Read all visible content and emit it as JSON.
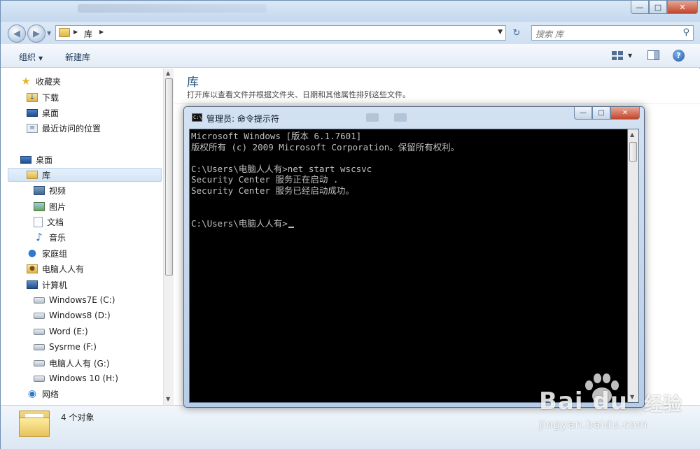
{
  "explorer": {
    "address": {
      "segment": "库"
    },
    "search": {
      "placeholder": "搜索 库"
    },
    "toolbar": {
      "organize_label": "组织",
      "new_library_label": "新建库"
    },
    "sidebar": {
      "favorites": {
        "label": "收藏夹",
        "items": [
          "下载",
          "桌面",
          "最近访问的位置"
        ]
      },
      "desktop": {
        "label": "桌面"
      },
      "libraries": {
        "label": "库",
        "items": [
          "视频",
          "图片",
          "文档",
          "音乐"
        ]
      },
      "homegroup": {
        "label": "家庭组"
      },
      "user": {
        "label": "电脑人人有"
      },
      "computer": {
        "label": "计算机",
        "drives": [
          "Windows7E (C:)",
          "Windows8 (D:)",
          "Word (E:)",
          "Sysrme (F:)",
          "电脑人人有 (G:)",
          "Windows 10 (H:)"
        ]
      },
      "network": {
        "label": "网络"
      }
    },
    "content": {
      "title": "库",
      "subtitle": "打开库以查看文件并根据文件夹、日期和其他属性排列这些文件。"
    },
    "details": {
      "count_text": "4 个对象"
    }
  },
  "cmd": {
    "title": "管理员: 命令提示符",
    "icon_text": "C:\\",
    "lines": [
      "Microsoft Windows [版本 6.1.7601]",
      "版权所有 (c) 2009 Microsoft Corporation。保留所有权利。",
      "",
      "C:\\Users\\电脑人人有>net start wscsvc",
      "Security Center 服务正在启动 .",
      "Security Center 服务已经启动成功。",
      "",
      "",
      "C:\\Users\\电脑人人有>"
    ]
  },
  "watermark": {
    "brand": "Bai  du",
    "cn": "经验",
    "url": "jingyan.baidu.com"
  },
  "colors": {
    "cmd_background": "#000000",
    "cmd_text": "#c0c0c0",
    "accent": "#1e4e79",
    "selection": "#d4e5f7"
  },
  "icons": {
    "favorites": "star-icon",
    "download": "download-folder-icon",
    "desktop": "desktop-icon",
    "recent": "recent-places-icon",
    "library": "library-icon",
    "video": "video-library-icon",
    "picture": "picture-library-icon",
    "document": "document-library-icon",
    "music": "music-note-icon",
    "homegroup": "homegroup-icon",
    "user": "user-folder-icon",
    "computer": "computer-icon",
    "drive": "drive-icon",
    "network": "network-icon"
  }
}
